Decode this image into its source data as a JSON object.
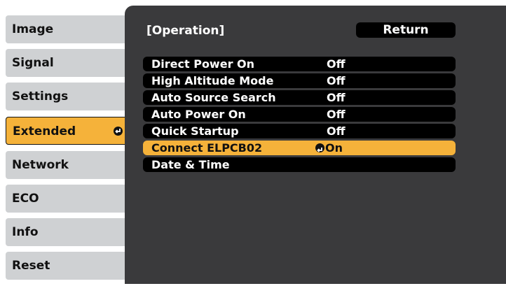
{
  "tabs": [
    {
      "label": "Image",
      "active": false
    },
    {
      "label": "Signal",
      "active": false
    },
    {
      "label": "Settings",
      "active": false
    },
    {
      "label": "Extended",
      "active": true
    },
    {
      "label": "Network",
      "active": false
    },
    {
      "label": "ECO",
      "active": false
    },
    {
      "label": "Info",
      "active": false
    },
    {
      "label": "Reset",
      "active": false
    }
  ],
  "panel": {
    "title": "[Operation]",
    "return_label": "Return"
  },
  "menu": [
    {
      "label": "Direct Power On",
      "value": "Off",
      "active": false
    },
    {
      "label": "High Altitude Mode",
      "value": "Off",
      "active": false
    },
    {
      "label": "Auto Source Search",
      "value": "Off",
      "active": false
    },
    {
      "label": "Auto Power On",
      "value": "Off",
      "active": false
    },
    {
      "label": "Quick Startup",
      "value": "Off",
      "active": false
    },
    {
      "label": "Connect ELPCB02",
      "value": "On",
      "active": true
    },
    {
      "label": "Date & Time",
      "value": "",
      "active": false
    }
  ],
  "colors": {
    "accent": "#f5b23a",
    "panel": "#3a3a3c",
    "tab": "#cfd1d3",
    "row": "#000000"
  },
  "icons": {
    "enter": "enter-icon"
  }
}
